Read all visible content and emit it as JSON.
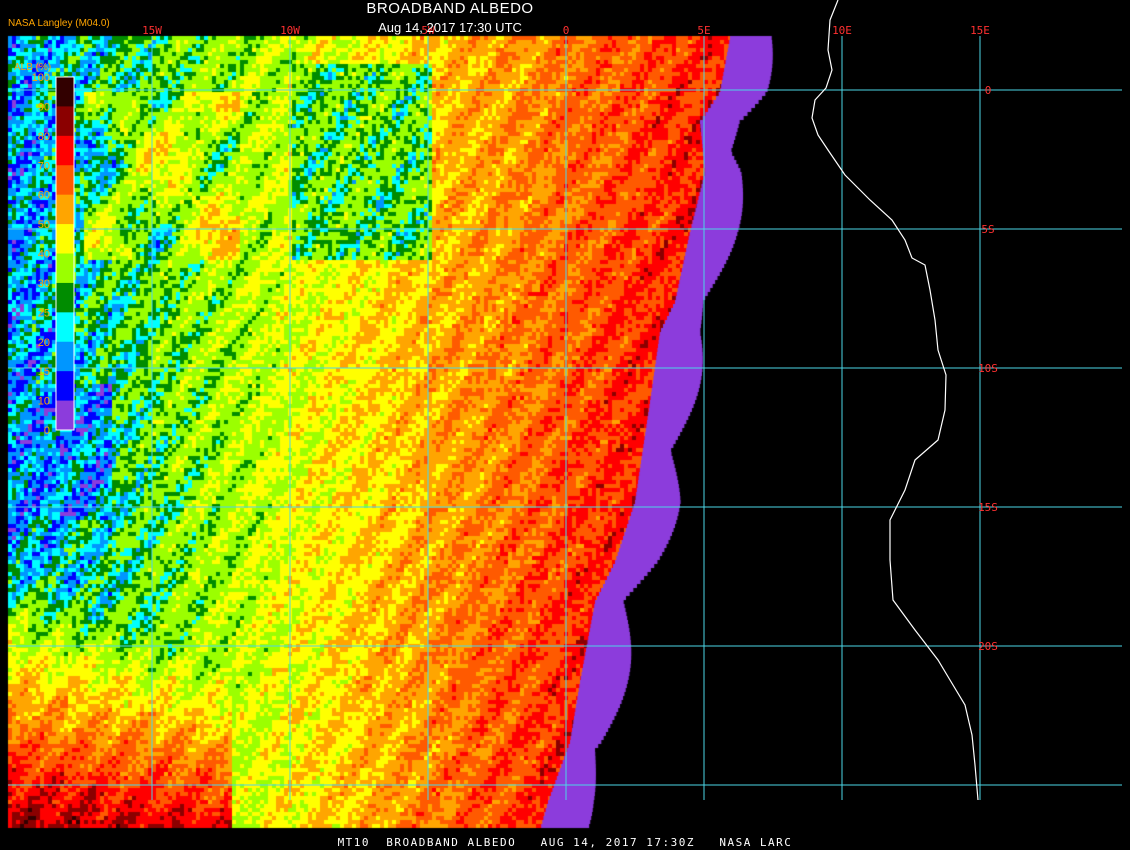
{
  "header": {
    "title": "BROADBAND ALBEDO",
    "subtitle": "Aug 14, 2017 17:30 UTC",
    "brand": "NASA Langley (M04.0)"
  },
  "footer": {
    "text": "MT10  BROADBAND ALBEDO   AUG 14, 2017 17:30Z   NASA LARC"
  },
  "legend": {
    "title": "ALB (%)",
    "ticks": [
      "100",
      "90",
      "80",
      "70",
      "60",
      "50",
      "40",
      "30",
      "25",
      "20",
      "15",
      "10",
      "0"
    ],
    "colors": [
      "#320000",
      "#8b0000",
      "#ff0000",
      "#ff5a00",
      "#ffa500",
      "#ffff00",
      "#9bff00",
      "#008c00",
      "#00ffff",
      "#0096ff",
      "#0000ff",
      "#8c3cdc"
    ]
  },
  "map": {
    "lon_labels": [
      "15W",
      "10W",
      "5W",
      "0",
      "5E",
      "10E",
      "15E"
    ],
    "lat_labels": [
      "0",
      "5S",
      "10S",
      "15S",
      "20S"
    ],
    "grid_color": "#4cd6e6",
    "label_color": "#ff3030",
    "land_color": "#000000",
    "coast_color": "#ffffff",
    "missing_color": "#8c3cdc"
  }
}
